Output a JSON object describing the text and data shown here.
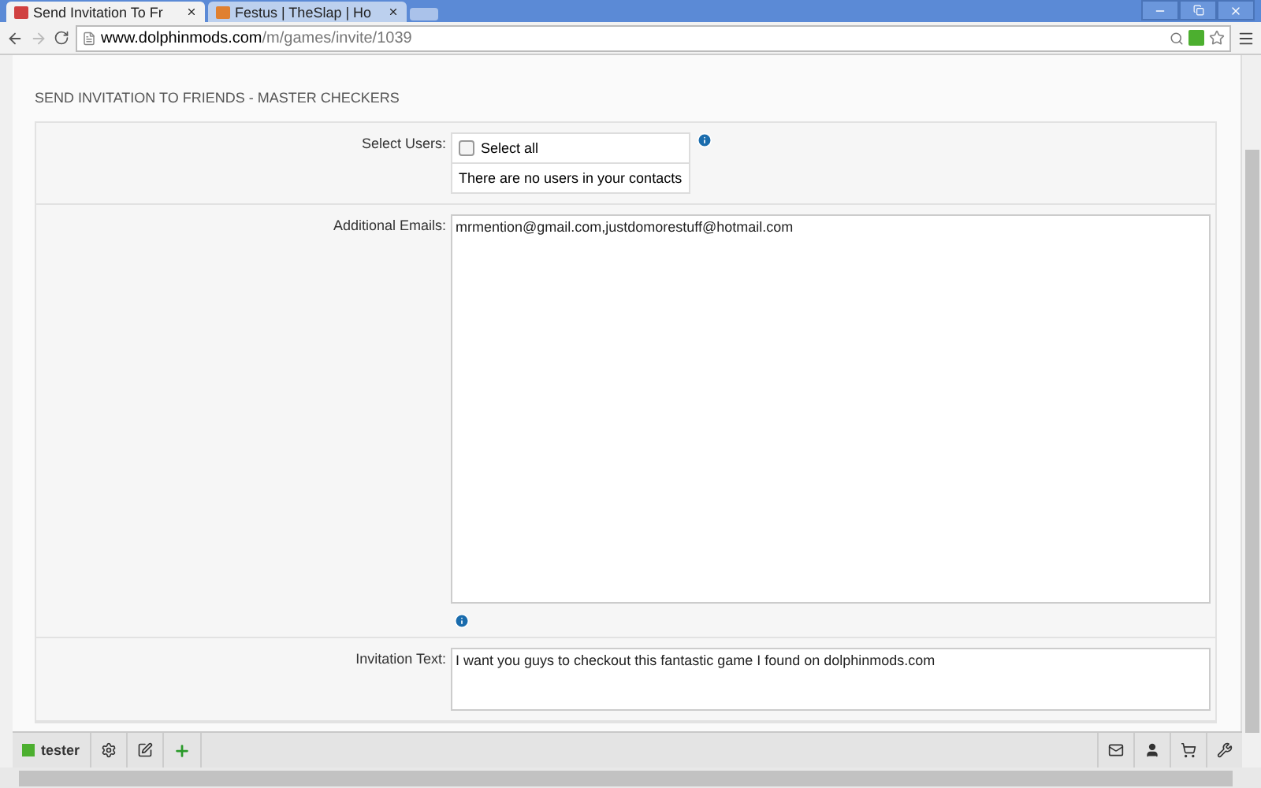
{
  "tabs": [
    {
      "label": "Send Invitation To Fr",
      "selected": true
    },
    {
      "label": "Festus | TheSlap | Ho",
      "selected": false
    }
  ],
  "address_bar": {
    "domain": "www.dolphinmods.com",
    "path": "/m/games/invite/1039"
  },
  "page": {
    "heading": "SEND INVITATION TO FRIENDS - MASTER CHECKERS",
    "select_users": {
      "label": "Select Users:",
      "select_all": {
        "label": "Select all",
        "checked": false
      },
      "empty_message": "There are no users in your contacts"
    },
    "additional_emails": {
      "label": "Additional Emails:",
      "value": "mrmention@gmail.com,justdomorestuff@hotmail.com"
    },
    "invitation_text": {
      "label": "Invitation Text:",
      "value": "I want you guys to checkout this fantastic game I found on dolphinmods.com"
    }
  },
  "toolbar": {
    "user": "tester"
  }
}
